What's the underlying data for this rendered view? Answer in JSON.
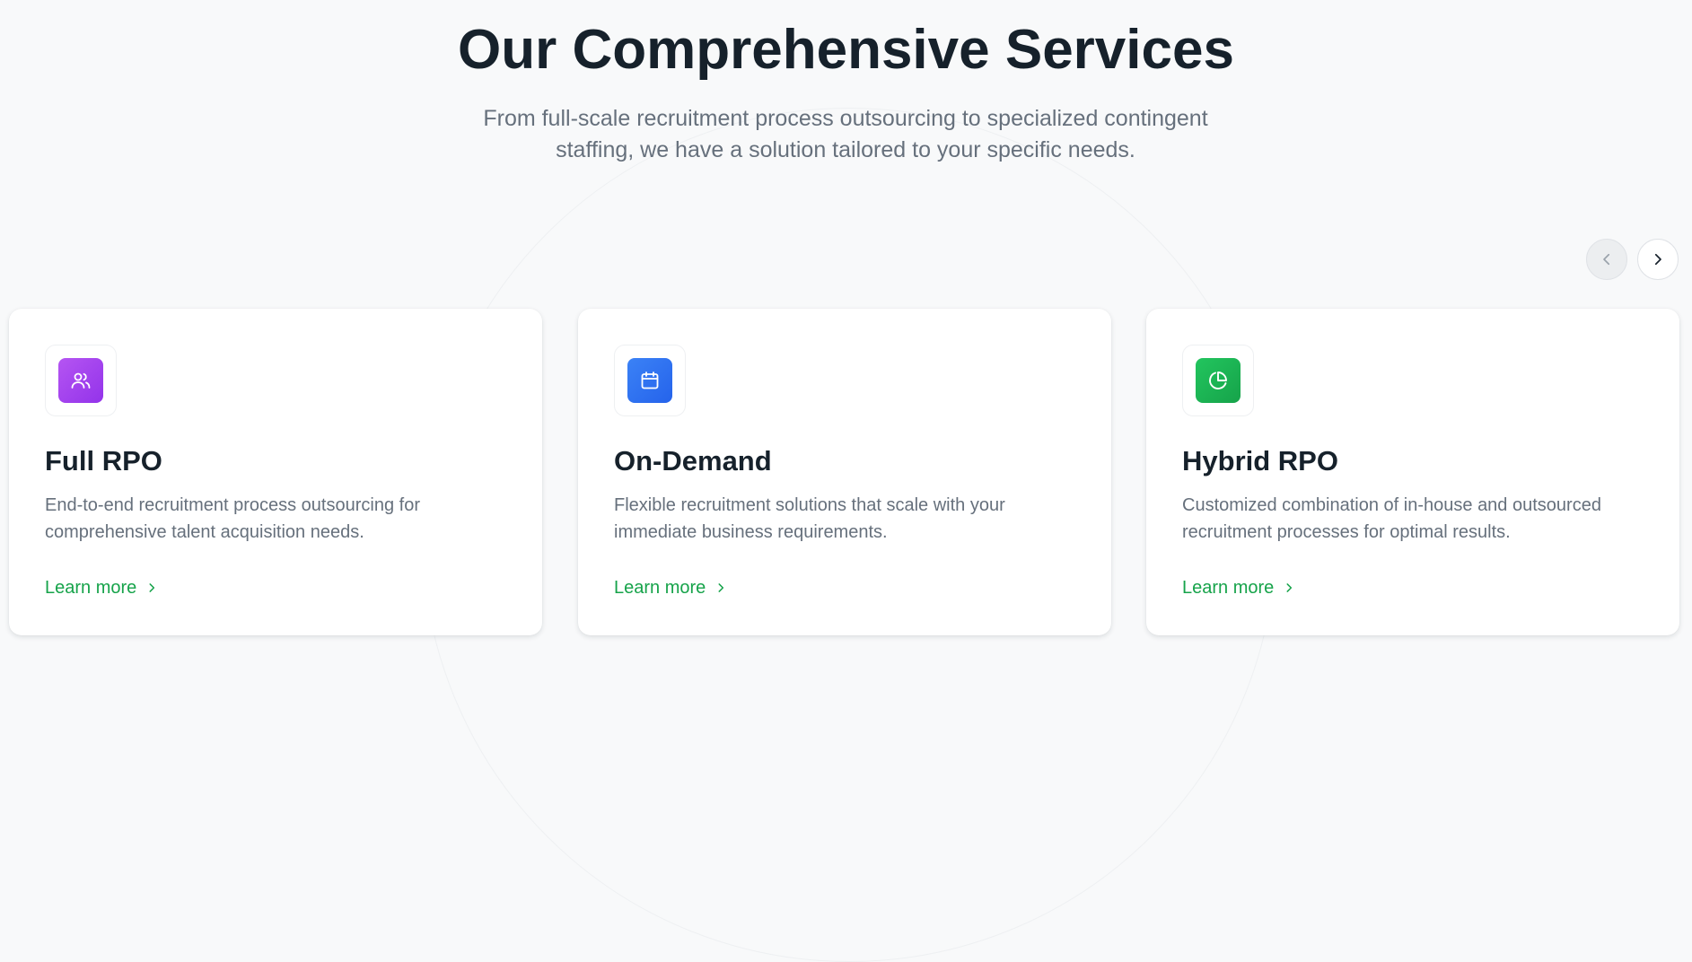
{
  "section": {
    "title": "Our Comprehensive Services",
    "subtitle": "From full-scale recruitment process outsourcing to specialized contingent staffing, we have a solution tailored to your specific needs."
  },
  "carousel": {
    "prev_icon": "chevron-left-icon",
    "next_icon": "chevron-right-icon"
  },
  "cards": [
    {
      "title": "Full RPO",
      "description": "End-to-end recruitment process outsourcing for comprehensive talent acquisition needs.",
      "link_label": "Learn more",
      "icon": "users-icon",
      "icon_color": "#a845ef"
    },
    {
      "title": "On-Demand",
      "description": "Flexible recruitment solutions that scale with your immediate business requirements.",
      "link_label": "Learn more",
      "icon": "calendar-icon",
      "icon_color": "#3178f0"
    },
    {
      "title": "Hybrid RPO",
      "description": "Customized combination of in-house and outsourced recruitment processes for optimal results.",
      "link_label": "Learn more",
      "icon": "pie-chart-icon",
      "icon_color": "#1cb456"
    }
  ],
  "colors": {
    "heading": "#16212b",
    "body_text": "#66707c",
    "link": "#16a34a",
    "background": "#f8f9fa"
  }
}
